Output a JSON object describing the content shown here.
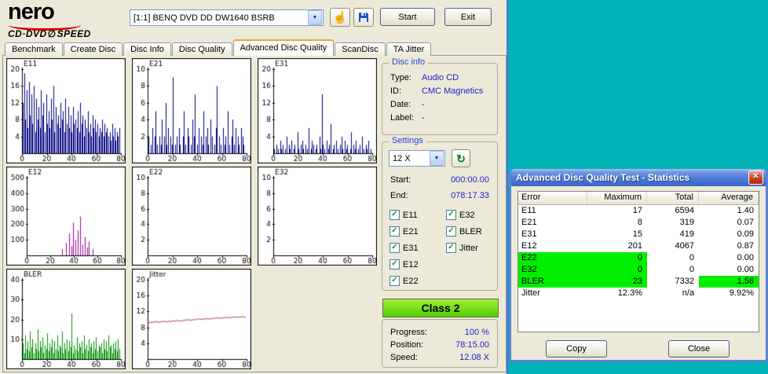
{
  "app": {
    "logo_line1": "nero",
    "logo_line2": "CD·DVD",
    "logo_symbol": "∅",
    "logo_speed": "SPEED",
    "drive_select": "[1:1]  BENQ DVD DD DW1640 BSRB",
    "start_button": "Start",
    "exit_button": "Exit"
  },
  "tabs": [
    {
      "label": "Benchmark",
      "selected": false
    },
    {
      "label": "Create Disc",
      "selected": false
    },
    {
      "label": "Disc Info",
      "selected": false
    },
    {
      "label": "Disc Quality",
      "selected": false
    },
    {
      "label": "Advanced Disc Quality",
      "selected": true
    },
    {
      "label": "ScanDisc",
      "selected": false
    },
    {
      "label": "TA Jitter",
      "selected": false
    }
  ],
  "disc_info": {
    "title": "Disc info",
    "rows": [
      {
        "label": "Type:",
        "value": "Audio CD"
      },
      {
        "label": "ID:",
        "value": "CMC Magnetics"
      },
      {
        "label": "Date:",
        "value": "-"
      },
      {
        "label": "Label:",
        "value": "-"
      }
    ]
  },
  "settings": {
    "title": "Settings",
    "speed_value": "12 X",
    "start_label": "Start:",
    "start_value": "000:00.00",
    "end_label": "End:",
    "end_value": "078:17.33",
    "checkboxes_left": [
      "E11",
      "E21",
      "E31",
      "E12",
      "E22"
    ],
    "checkboxes_right": [
      "E32",
      "BLER",
      "Jitter"
    ]
  },
  "classification": {
    "label": "Class 2"
  },
  "progress": {
    "rows": [
      {
        "label": "Progress:",
        "value": "100 %"
      },
      {
        "label": "Position:",
        "value": "78:15.00"
      },
      {
        "label": "Speed:",
        "value": "12.08 X"
      }
    ]
  },
  "stats_window": {
    "title": "Advanced Disc Quality Test - Statistics",
    "columns": [
      "Error",
      "Maximum",
      "Total",
      "Average"
    ],
    "rows": [
      {
        "error": "E11",
        "maximum": "17",
        "total": "6594",
        "average": "1.40",
        "row_green": false,
        "avg_green": false
      },
      {
        "error": "E21",
        "maximum": "8",
        "total": "319",
        "average": "0.07",
        "row_green": false,
        "avg_green": false
      },
      {
        "error": "E31",
        "maximum": "15",
        "total": "419",
        "average": "0.09",
        "row_green": false,
        "avg_green": false
      },
      {
        "error": "E12",
        "maximum": "201",
        "total": "4067",
        "average": "0.87",
        "row_green": false,
        "avg_green": false
      },
      {
        "error": "E22",
        "maximum": "0",
        "total": "0",
        "average": "0.00",
        "row_green": true,
        "avg_green": false
      },
      {
        "error": "E32",
        "maximum": "0",
        "total": "0",
        "average": "0.00",
        "row_green": true,
        "avg_green": false
      },
      {
        "error": "BLER",
        "maximum": "23",
        "total": "7332",
        "average": "1.56",
        "row_green": true,
        "avg_green": true
      },
      {
        "error": "Jitter",
        "maximum": "12.3%",
        "total": "n/a",
        "average": "9.92%",
        "row_green": false,
        "avg_green": false
      }
    ],
    "copy_button": "Copy",
    "close_button": "Close"
  },
  "chart_data": [
    {
      "name": "E11",
      "type": "bar",
      "color": "#000080",
      "ymax": 20,
      "yticks": [
        4,
        8,
        12,
        16,
        20
      ],
      "xticks": [
        0,
        20,
        40,
        60,
        80
      ],
      "xlim": [
        0,
        80
      ],
      "values": [
        12,
        19,
        8,
        15,
        6,
        17,
        9,
        14,
        7,
        16,
        5,
        13,
        8,
        11,
        6,
        15,
        9,
        12,
        5,
        14,
        7,
        10,
        6,
        13,
        8,
        16,
        5,
        11,
        7,
        9,
        6,
        12,
        8,
        10,
        5,
        13,
        7,
        11,
        6,
        9,
        5,
        11,
        7,
        8,
        6,
        10,
        5,
        12,
        7,
        9,
        4,
        8,
        6,
        10,
        5,
        7,
        4,
        9,
        6,
        8,
        5,
        7,
        4,
        6,
        5,
        8,
        4,
        7,
        5,
        6,
        4,
        5,
        3,
        7,
        4,
        6,
        3,
        5,
        4,
        6
      ]
    },
    {
      "name": "E21",
      "type": "bar",
      "color": "#000080",
      "ymax": 10,
      "yticks": [
        2,
        4,
        6,
        8,
        10
      ],
      "xticks": [
        0,
        20,
        40,
        60,
        80
      ],
      "xlim": [
        0,
        80
      ],
      "values": [
        2,
        0,
        1,
        3,
        0,
        2,
        5,
        1,
        0,
        2,
        1,
        4,
        0,
        2,
        6,
        1,
        3,
        0,
        2,
        1,
        9,
        0,
        1,
        2,
        0,
        3,
        1,
        0,
        2,
        5,
        1,
        0,
        3,
        2,
        0,
        1,
        4,
        2,
        7,
        0,
        1,
        3,
        0,
        2,
        1,
        5,
        0,
        2,
        3,
        1,
        0,
        4,
        2,
        0,
        1,
        3,
        8,
        0,
        2,
        1,
        0,
        3,
        1,
        2,
        0,
        5,
        1,
        0,
        2,
        4,
        1,
        3,
        0,
        2,
        1,
        0,
        3,
        2,
        1,
        0
      ]
    },
    {
      "name": "E31",
      "type": "bar",
      "color": "#000080",
      "ymax": 20,
      "yticks": [
        4,
        8,
        12,
        16,
        20
      ],
      "xticks": [
        0,
        20,
        40,
        60,
        80
      ],
      "xlim": [
        0,
        80
      ],
      "values": [
        1,
        0,
        2,
        1,
        0,
        3,
        1,
        2,
        0,
        1,
        4,
        0,
        2,
        1,
        3,
        0,
        1,
        2,
        0,
        5,
        1,
        0,
        2,
        3,
        1,
        0,
        2,
        1,
        6,
        0,
        1,
        3,
        2,
        0,
        1,
        2,
        0,
        4,
        1,
        14,
        2,
        1,
        0,
        3,
        1,
        2,
        7,
        0,
        1,
        2,
        0,
        3,
        1,
        0,
        2,
        4,
        1,
        0,
        3,
        1,
        2,
        0,
        1,
        5,
        0,
        2,
        1,
        3,
        0,
        1,
        2,
        0,
        4,
        1,
        0,
        2,
        1,
        3,
        0,
        1
      ]
    },
    {
      "name": "E12",
      "type": "bar",
      "color": "#990099",
      "ymax": 500,
      "yticks": [
        100,
        200,
        300,
        400,
        500
      ],
      "xticks": [
        0,
        20,
        40,
        60,
        80
      ],
      "xlim": [
        0,
        80
      ],
      "values": [
        0,
        0,
        0,
        0,
        0,
        0,
        0,
        0,
        0,
        0,
        0,
        0,
        0,
        0,
        0,
        0,
        0,
        0,
        0,
        0,
        0,
        0,
        0,
        0,
        0,
        0,
        0,
        0,
        0,
        0,
        40,
        0,
        0,
        80,
        0,
        0,
        140,
        0,
        60,
        210,
        0,
        100,
        0,
        160,
        0,
        250,
        0,
        70,
        0,
        120,
        0,
        50,
        0,
        90,
        0,
        0,
        40,
        0,
        0,
        0,
        0,
        0,
        0,
        0,
        0,
        0,
        0,
        0,
        0,
        0,
        0,
        0,
        0,
        0,
        0,
        0,
        0,
        0,
        0,
        0
      ]
    },
    {
      "name": "E22",
      "type": "bar",
      "color": "#000080",
      "ymax": 10,
      "yticks": [
        2,
        4,
        6,
        8,
        10
      ],
      "xticks": [
        0,
        20,
        40,
        60,
        80
      ],
      "xlim": [
        0,
        80
      ],
      "values": []
    },
    {
      "name": "E32",
      "type": "bar",
      "color": "#000080",
      "ymax": 10,
      "yticks": [
        2,
        4,
        6,
        8,
        10
      ],
      "xticks": [
        0,
        20,
        40,
        60,
        80
      ],
      "xlim": [
        0,
        80
      ],
      "values": []
    },
    {
      "name": "BLER",
      "type": "bar",
      "color": "#009000",
      "ymax": 40,
      "yticks": [
        10,
        20,
        30,
        40
      ],
      "xticks": [
        0,
        20,
        40,
        60,
        80
      ],
      "xlim": [
        0,
        80
      ],
      "values": [
        8,
        3,
        12,
        5,
        9,
        4,
        14,
        6,
        10,
        3,
        8,
        5,
        15,
        4,
        9,
        6,
        11,
        3,
        7,
        5,
        13,
        4,
        8,
        6,
        10,
        3,
        9,
        5,
        12,
        4,
        7,
        6,
        14,
        3,
        8,
        5,
        10,
        4,
        9,
        6,
        23,
        3,
        7,
        5,
        11,
        4,
        8,
        6,
        9,
        3,
        12,
        5,
        7,
        4,
        10,
        6,
        8,
        3,
        9,
        5,
        11,
        4,
        7,
        6,
        8,
        3,
        10,
        5,
        9,
        4,
        12,
        6,
        7,
        3,
        8,
        5,
        9,
        4,
        10,
        5
      ]
    },
    {
      "name": "Jitter",
      "type": "line",
      "color": "#993366",
      "ymax": 20,
      "yticks": [
        4,
        8,
        12,
        16,
        20
      ],
      "xticks": [
        0,
        20,
        40,
        60,
        80
      ],
      "xlim": [
        0,
        80
      ],
      "values": [
        9.2,
        9.3,
        9.1,
        9.4,
        9.2,
        9.3,
        9.5,
        9.3,
        9.4,
        9.2,
        9.5,
        9.3,
        9.6,
        9.4,
        9.5,
        9.3,
        9.6,
        9.5,
        9.4,
        9.6,
        9.7,
        9.5,
        9.6,
        9.8,
        9.6,
        9.7,
        9.5,
        9.8,
        9.6,
        9.9,
        9.7,
        9.8,
        10.0,
        9.8,
        9.9,
        9.7,
        10.0,
        9.8,
        10.1,
        9.9,
        10.0,
        10.2,
        10.0,
        10.1,
        9.9,
        10.2,
        10.0,
        10.3,
        10.1,
        10.2,
        10.0,
        10.3,
        10.1,
        10.4,
        10.2,
        10.3,
        10.5,
        10.3,
        10.4,
        10.2,
        10.5,
        10.3,
        10.6,
        10.4,
        10.5,
        10.3,
        10.6,
        10.4,
        10.5,
        10.7,
        10.5,
        10.6,
        10.4,
        10.7,
        10.5,
        10.6,
        10.8,
        10.6,
        10.5,
        10.7
      ]
    }
  ]
}
